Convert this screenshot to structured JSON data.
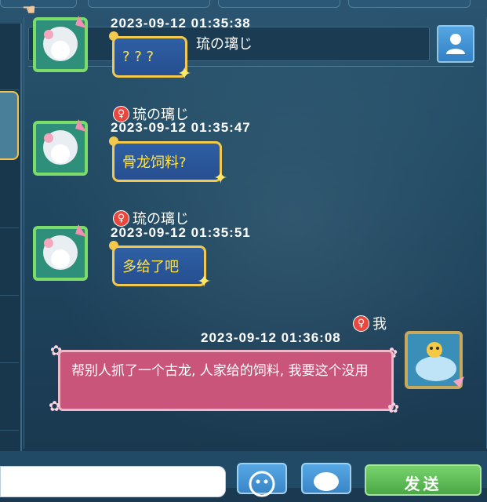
{
  "header": {
    "title": "琉の璃じ"
  },
  "messages": [
    {
      "timestamp": "2023-09-12 01:35:38",
      "text": "? ? ?",
      "sender": ""
    },
    {
      "timestamp": "2023-09-12 01:35:47",
      "text": "骨龙饲料?",
      "sender": "琉の璃じ",
      "gender_symbol": "♀"
    },
    {
      "timestamp": "2023-09-12 01:35:51",
      "text": "多给了吧",
      "sender": "琉の璃じ",
      "gender_symbol": "♀"
    },
    {
      "timestamp": "2023-09-12 01:36:08",
      "text": "帮别人抓了一个古龙, 人家给的饲料, 我要这个没用",
      "sender": "我",
      "gender_symbol": "♀"
    }
  ],
  "composer": {
    "send_label": "发送"
  },
  "colors": {
    "accent_gold": "#f2c94c",
    "bubble_blue": "#2e5fa4",
    "bubble_pink": "#c9557a",
    "send_green": "#4aa845"
  },
  "icons": {
    "profile": "person-icon",
    "emoji": "emoji-icon",
    "voice": "speech-bubble-icon",
    "gender": "female-icon"
  }
}
